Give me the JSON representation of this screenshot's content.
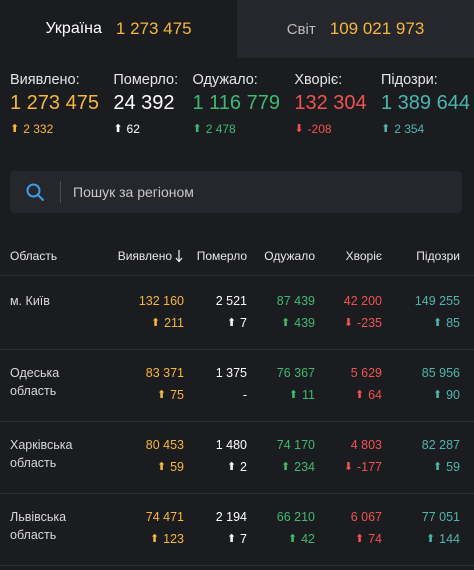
{
  "tabs": [
    {
      "name": "Україна",
      "count": "1 273 475"
    },
    {
      "name": "Світ",
      "count": "109 021 973"
    }
  ],
  "stats": [
    {
      "label": "Виявлено:",
      "value": "1 273 475",
      "delta": "2 332",
      "color": "#f6b73c",
      "delta_color": "#f6b73c",
      "direction": "up"
    },
    {
      "label": "Померло:",
      "value": "24 392",
      "delta": "62",
      "color": "#ffffff",
      "delta_color": "#ffffff",
      "direction": "up"
    },
    {
      "label": "Одужало:",
      "value": "1 116 779",
      "delta": "2 478",
      "color": "#3dba72",
      "delta_color": "#3dba72",
      "direction": "up"
    },
    {
      "label": "Хворіє:",
      "value": "132 304",
      "delta": "-208",
      "color": "#ef5350",
      "delta_color": "#ef5350",
      "direction": "down"
    },
    {
      "label": "Підозри:",
      "value": "1 389 644",
      "delta": "2 354",
      "color": "#4db6ac",
      "delta_color": "#4db6ac",
      "direction": "up"
    }
  ],
  "search": {
    "placeholder": "Пошук за регіоном",
    "icon": "search-icon"
  },
  "table": {
    "headers": {
      "region": "Область",
      "confirmed": "Виявлено",
      "deaths": "Померло",
      "recovered": "Одужало",
      "sick": "Хворіє",
      "suspected": "Підозри"
    },
    "sort_icon": "arrow-down",
    "rows": [
      {
        "region_line1": "м. Київ",
        "region_line2": "",
        "confirmed": "132 160",
        "confirmed_delta": "211",
        "deaths": "2 521",
        "deaths_delta": "7",
        "recovered": "87 439",
        "recovered_delta": "439",
        "sick": "42 200",
        "sick_delta": "-235",
        "sick_dir": "down",
        "suspected": "149 255",
        "suspected_delta": "85"
      },
      {
        "region_line1": "Одеська область",
        "region_line2": "",
        "confirmed": "83 371",
        "confirmed_delta": "75",
        "deaths": "1 375",
        "deaths_delta": "-",
        "recovered": "76 367",
        "recovered_delta": "11",
        "sick": "5 629",
        "sick_delta": "64",
        "sick_dir": "up",
        "suspected": "85 956",
        "suspected_delta": "90"
      },
      {
        "region_line1": "Харківська",
        "region_line2": "область",
        "confirmed": "80 453",
        "confirmed_delta": "59",
        "deaths": "1 480",
        "deaths_delta": "2",
        "recovered": "74 170",
        "recovered_delta": "234",
        "sick": "4 803",
        "sick_delta": "-177",
        "sick_dir": "down",
        "suspected": "82 287",
        "suspected_delta": "59"
      },
      {
        "region_line1": "Львівська",
        "region_line2": "область",
        "confirmed": "74 471",
        "confirmed_delta": "123",
        "deaths": "2 194",
        "deaths_delta": "7",
        "recovered": "66 210",
        "recovered_delta": "42",
        "sick": "6 067",
        "sick_delta": "74",
        "sick_dir": "up",
        "suspected": "77 051",
        "suspected_delta": "144"
      }
    ]
  }
}
